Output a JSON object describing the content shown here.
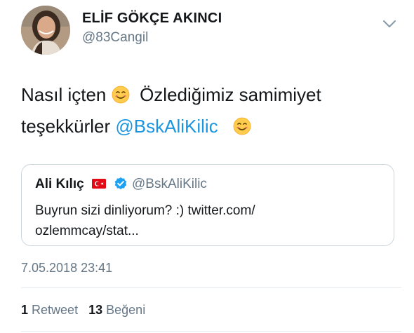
{
  "author": {
    "display_name": "ELİF GÖKÇE AKINCI",
    "handle": "@83Cangil"
  },
  "menu": {
    "icon": "chevron-down-icon"
  },
  "tweet": {
    "line1_part1": "Nasıl içten",
    "line1_part2": "Özlediğimiz samimiyet",
    "line2_part1": "teşekkürler",
    "mention": "@BskAliKilic",
    "emoji": "smiling-face-icon"
  },
  "quoted": {
    "display_name": "Ali Kılıç",
    "flag_icon": "turkey-flag-icon",
    "verified_icon": "verified-badge-icon",
    "handle": "@BskAliKilic",
    "text_line1": "Buyrun sizi dinliyorum? :) twitter.com/",
    "text_line2": "ozlemmcay/stat..."
  },
  "timestamp": "7.05.2018 23:41",
  "stats": {
    "retweet_count": "1",
    "retweet_label": "Retweet",
    "like_count": "13",
    "like_label": "Beğeni"
  },
  "colors": {
    "link": "#1b95e0",
    "secondary_text": "#657786",
    "verified": "#1da1f2",
    "border": "#ccd6dd"
  }
}
